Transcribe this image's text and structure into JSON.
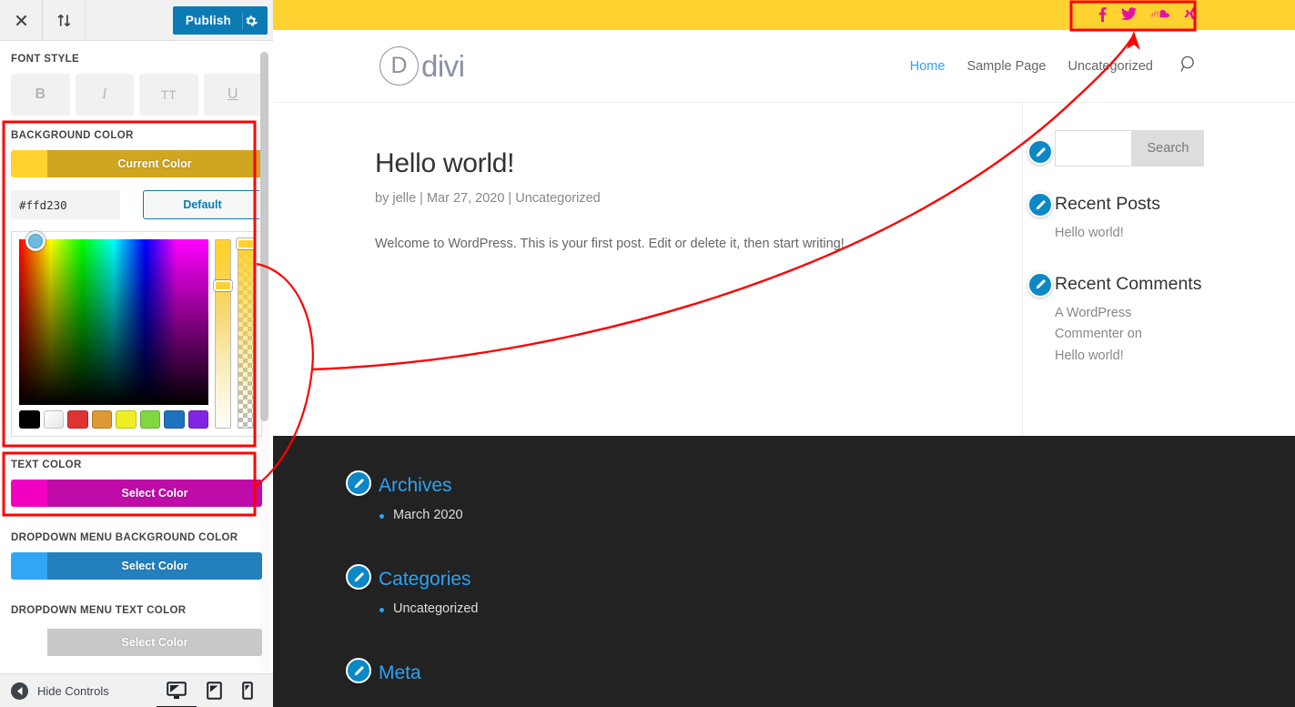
{
  "customizer": {
    "topbar": {
      "close_icon": "close-icon",
      "reorder_icon": "sort-arrows-icon",
      "publish_label": "Publish",
      "gear_icon": "gear-icon"
    },
    "font_style": {
      "label": "FONT STYLE",
      "buttons": [
        {
          "name": "bold",
          "glyph": "B"
        },
        {
          "name": "italic",
          "glyph": "I"
        },
        {
          "name": "uppercase",
          "glyph": "TT"
        },
        {
          "name": "underline",
          "glyph": "U"
        }
      ]
    },
    "background_color": {
      "label": "BACKGROUND COLOR",
      "button_label": "Current Color",
      "swatch_color": "#ffd230",
      "bar_color": "#cfa620",
      "hex_value": "#ffd230",
      "default_label": "Default"
    },
    "picker": {
      "swatches": [
        "#000000",
        "#ffffff",
        "#dd3333",
        "#dd9933",
        "#eeee22",
        "#81d742",
        "#1e73be",
        "#8224e3"
      ]
    },
    "text_color": {
      "label": "TEXT COLOR",
      "button_label": "Select Color",
      "swatch_color": "#f000c0",
      "bar_color": "#bf0ba8"
    },
    "dropdown_bg_color": {
      "label": "DROPDOWN MENU BACKGROUND COLOR",
      "button_label": "Select Color",
      "swatch_color": "#32a6f5",
      "bar_color": "#2380bd"
    },
    "dropdown_text_color": {
      "label": "DROPDOWN MENU TEXT COLOR",
      "button_label": "Select Color",
      "swatch_color": "#c9c9c9",
      "bar_color": "#c9c9c9"
    },
    "bottom": {
      "hide_controls_label": "Hide Controls",
      "devices": [
        {
          "name": "desktop",
          "active": true
        },
        {
          "name": "tablet",
          "active": false
        },
        {
          "name": "mobile",
          "active": false
        }
      ]
    }
  },
  "preview": {
    "topbar_color": "#ffd230",
    "social": [
      {
        "name": "facebook-icon",
        "glyph": "f"
      },
      {
        "name": "twitter-icon",
        "glyph": "t"
      },
      {
        "name": "soundcloud-icon",
        "glyph": "s"
      },
      {
        "name": "xing-icon",
        "glyph": "x"
      }
    ],
    "social_color": "#e312a6",
    "logo": {
      "mark": "D",
      "word": "divi"
    },
    "nav": [
      {
        "label": "Home",
        "active": true
      },
      {
        "label": "Sample Page",
        "active": false
      },
      {
        "label": "Uncategorized",
        "active": false
      }
    ],
    "nav_search_icon": "search-icon",
    "post": {
      "title": "Hello world!",
      "meta": "by jelle  |  Mar 27, 2020  |  Uncategorized",
      "body": "Welcome to WordPress. This is your first post. Edit or delete it, then start writing!"
    },
    "sidebar": {
      "search": {
        "placeholder": "",
        "value": "",
        "submit_label": "Search"
      },
      "recent_posts": {
        "title": "Recent Posts",
        "items": [
          "Hello world!"
        ]
      },
      "recent_comments": {
        "title": "Recent Comments",
        "items": [
          "A WordPress Commenter on Hello world!"
        ]
      }
    },
    "footer": {
      "widgets": [
        {
          "title": "Archives",
          "items": [
            "March 2020"
          ]
        },
        {
          "title": "Categories",
          "items": [
            "Uncategorized"
          ]
        },
        {
          "title": "Meta",
          "items": []
        }
      ]
    }
  },
  "annotation": {
    "color": "#ff0000"
  }
}
